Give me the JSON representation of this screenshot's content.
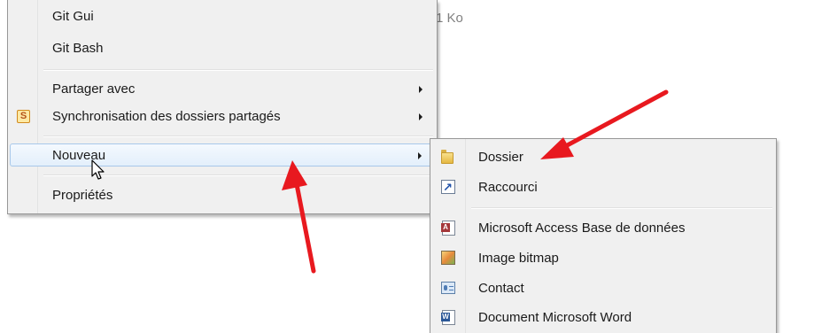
{
  "background": {
    "size_text": "1 Ko"
  },
  "context_menu": {
    "items": [
      {
        "label": "Git Gui"
      },
      {
        "label": "Git Bash"
      },
      {
        "label": "Partager avec",
        "has_submenu": true
      },
      {
        "label": "Synchronisation des dossiers partagés",
        "has_submenu": true,
        "icon": "sync-folders-icon",
        "icon_glyph": "S"
      },
      {
        "label": "Nouveau",
        "has_submenu": true,
        "highlighted": true
      },
      {
        "label": "Propriétés"
      }
    ]
  },
  "new_submenu": {
    "items": [
      {
        "label": "Dossier",
        "icon": "folder-icon"
      },
      {
        "label": "Raccourci",
        "icon": "shortcut-icon"
      },
      {
        "label": "Microsoft Access Base de données",
        "icon": "access-database-icon",
        "icon_glyph": "A"
      },
      {
        "label": "Image bitmap",
        "icon": "bitmap-image-icon"
      },
      {
        "label": "Contact",
        "icon": "contact-icon"
      },
      {
        "label": "Document Microsoft Word",
        "icon": "word-document-icon",
        "icon_glyph": "W"
      }
    ]
  },
  "annotations": {
    "arrow_color": "#e8191f",
    "arrows": [
      "arrow-to-nouveau",
      "arrow-to-dossier"
    ]
  },
  "colors": {
    "menu_background": "#f0f0f0",
    "highlight_border": "#a8c8ea",
    "annotation_red": "#e8191f"
  }
}
